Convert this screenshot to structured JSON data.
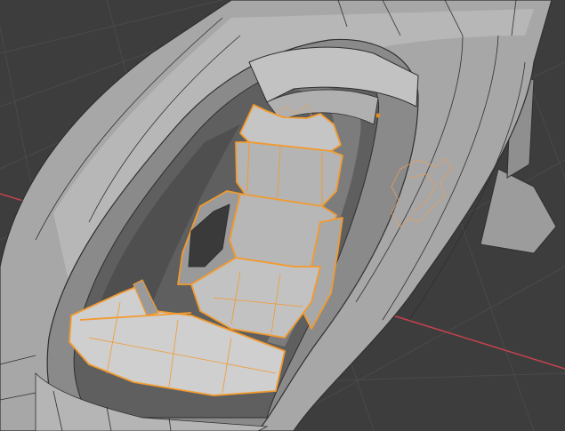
{
  "viewport": {
    "background": "#3d3d3d",
    "grid_color": "#4a4a4a",
    "x_axis_color": "#c7424f",
    "mesh_fill": "#a7a7a7",
    "mesh_light": "#c4c4c4",
    "mesh_dark": "#6e6e6e",
    "edge_color": "#2f2f2f",
    "selection_color": "#f29a2e",
    "selected_object": "seat",
    "hidden_outline_object": "pilot-figure"
  }
}
